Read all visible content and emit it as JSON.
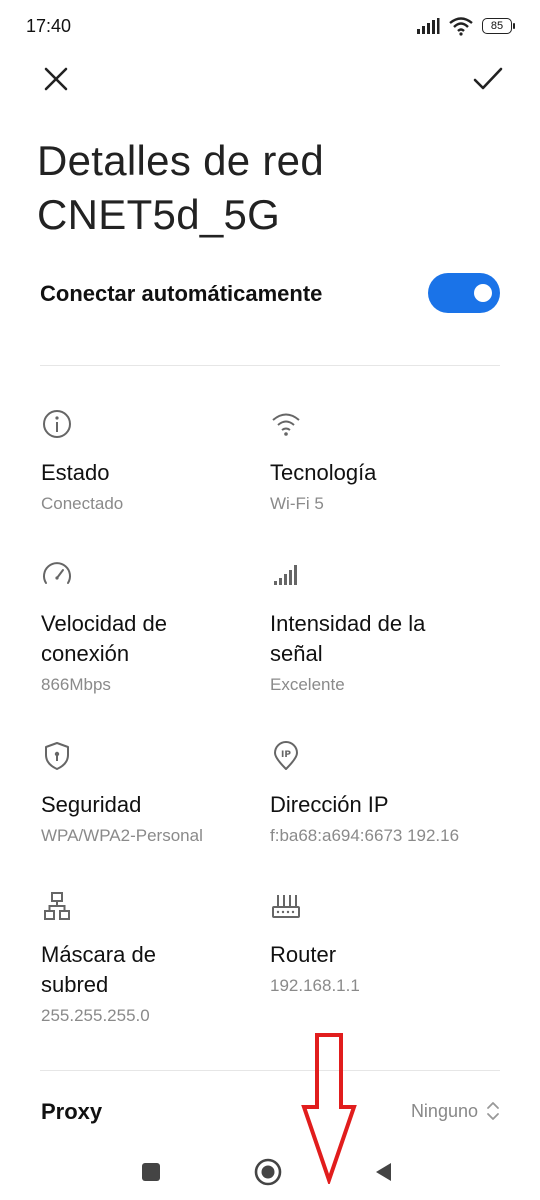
{
  "status_bar": {
    "time": "17:40",
    "battery": "85",
    "icons": [
      "cell-signal-icon",
      "wifi-icon",
      "battery-icon"
    ]
  },
  "header": {
    "close_icon": "close-icon",
    "confirm_icon": "check-icon"
  },
  "title": {
    "line1": "Detalles de red",
    "line2": "CNET5d_5G"
  },
  "auto_connect": {
    "label": "Conectar automáticamente",
    "enabled": true,
    "accent": "#1a73e8"
  },
  "details": [
    {
      "icon": "info-icon",
      "label": "Estado",
      "value": "Conectado"
    },
    {
      "icon": "wifi-icon",
      "label": "Tecnología",
      "value": "Wi-Fi 5"
    },
    {
      "icon": "speedometer-icon",
      "label": "Velocidad de\nconexión",
      "value": "866Mbps"
    },
    {
      "icon": "signal-strength-icon",
      "label": "Intensidad de la\nseñal",
      "value": "Excelente"
    },
    {
      "icon": "shield-icon",
      "label": "Seguridad",
      "value": "WPA/WPA2-Personal"
    },
    {
      "icon": "ip-location-icon",
      "label": "Dirección IP",
      "value": "f:ba68:a694:6673 192.16"
    },
    {
      "icon": "network-topology-icon",
      "label": "Máscara de\nsubred",
      "value": "255.255.255.0"
    },
    {
      "icon": "router-icon",
      "label": "Router",
      "value": "192.168.1.1"
    }
  ],
  "proxy": {
    "label": "Proxy",
    "value": "Ninguno"
  },
  "nav_bar": {
    "icons": [
      "recents-square-icon",
      "home-circle-icon",
      "back-triangle-icon"
    ]
  },
  "annotation": {
    "icon": "red-down-arrow-icon",
    "color": "#e11d1d"
  }
}
